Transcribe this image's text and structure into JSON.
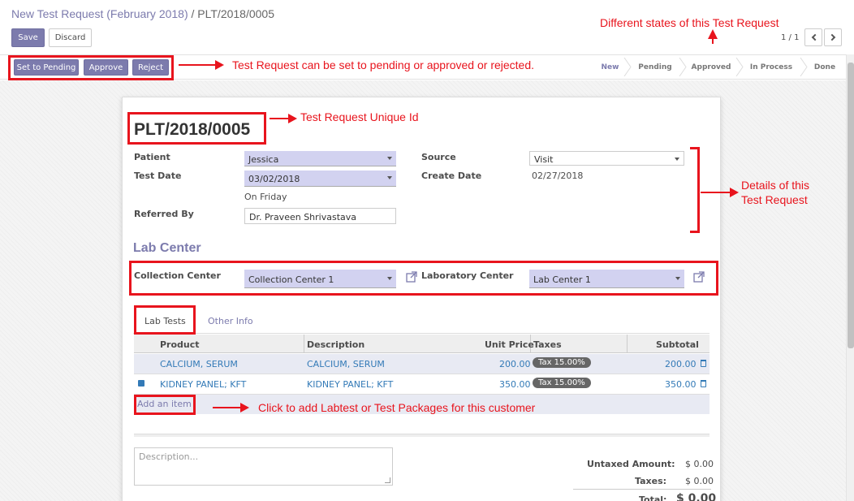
{
  "breadcrumb": {
    "parent": "New Test Request (February 2018)",
    "separator": " / ",
    "current": "PLT/2018/0005"
  },
  "toolbar": {
    "save": "Save",
    "discard": "Discard",
    "pager": "1 / 1",
    "prev_icon": "chevron-left-icon",
    "next_icon": "chevron-right-icon"
  },
  "actions": {
    "set_pending": "Set to Pending",
    "approve": "Approve",
    "reject": "Reject"
  },
  "statusbar": [
    "New",
    "Pending",
    "Approved",
    "In Process",
    "Done"
  ],
  "annotations": {
    "states": "Different states of this Test Request",
    "buttons": "Test Request can be set to pending or approved or rejected.",
    "unique_id": "Test Request Unique Id",
    "details_line1": "Details of this",
    "details_line2": "Test Request",
    "add_item": "Click to add Labtest or Test Packages for this customer"
  },
  "form": {
    "title": "PLT/2018/0005",
    "patient_label": "Patient",
    "patient_value": "Jessica",
    "test_date_label": "Test Date",
    "test_date_value": "03/02/2018",
    "test_day": "On Friday",
    "referred_by_label": "Referred By",
    "referred_by_value": "Dr. Praveen Shrivastava",
    "source_label": "Source",
    "source_value": "Visit",
    "create_date_label": "Create Date",
    "create_date_value": "02/27/2018",
    "section_title": "Lab Center",
    "collection_center_label": "Collection Center",
    "collection_center_value": "Collection Center 1",
    "laboratory_center_label": "Laboratory Center",
    "laboratory_center_value": "Lab Center 1"
  },
  "tabs": [
    "Lab Tests",
    "Other Info"
  ],
  "table": {
    "headers": {
      "product": "Product",
      "description": "Description",
      "unit_price": "Unit Price",
      "taxes": "Taxes",
      "subtotal": "Subtotal"
    },
    "rows": [
      {
        "product": "CALCIUM, SERUM",
        "description": "CALCIUM, SERUM",
        "unit_price": "200.00",
        "tax": "Tax 15.00%",
        "subtotal": "200.00"
      },
      {
        "product": "KIDNEY PANEL; KFT",
        "description": "KIDNEY PANEL; KFT",
        "unit_price": "350.00",
        "tax": "Tax 15.00%",
        "subtotal": "350.00"
      }
    ],
    "add_item": "Add an item"
  },
  "description_placeholder": "Description...",
  "totals": {
    "untaxed_label": "Untaxed Amount:",
    "untaxed_value": "$ 0.00",
    "taxes_label": "Taxes:",
    "taxes_value": "$ 0.00",
    "total_label": "Total:",
    "total_value": "$ 0.00"
  },
  "colors": {
    "primary": "#7c7bad",
    "annotation": "#e8141d",
    "link": "#337ab7"
  }
}
